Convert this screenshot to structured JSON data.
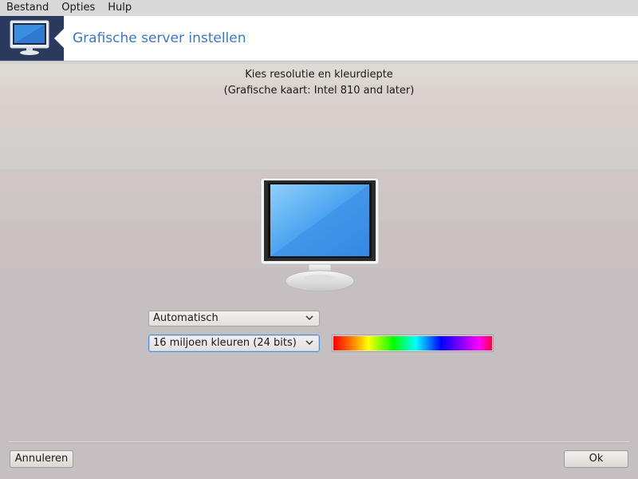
{
  "menubar": {
    "items": [
      {
        "label": "Bestand"
      },
      {
        "label": "Opties"
      },
      {
        "label": "Hulp"
      }
    ]
  },
  "header": {
    "title": "Grafische server instellen",
    "icon": "monitor-icon"
  },
  "intro": {
    "line1": "Kies resolutie en kleurdiepte",
    "line2": "(Grafische kaart: Intel 810 and later)"
  },
  "resolution": {
    "selected": "Automatisch"
  },
  "color_depth": {
    "selected": "16 miljoen kleuren (24 bits)"
  },
  "buttons": {
    "cancel": "Annuleren",
    "ok": "Ok"
  },
  "colors": {
    "accent": "#3c78c8",
    "header_icon_bg": "#2b3a5c",
    "focus_border": "#4b8ed6"
  }
}
